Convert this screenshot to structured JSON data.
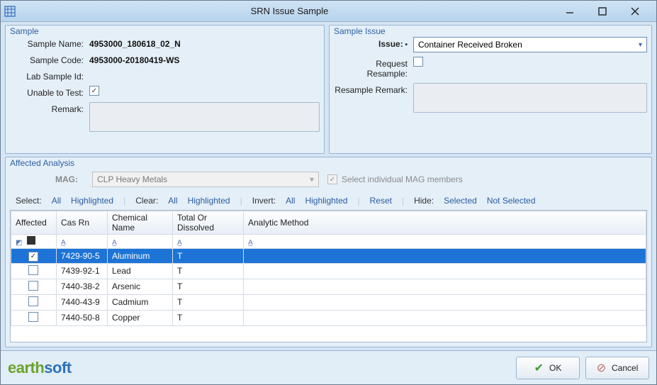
{
  "window": {
    "title": "SRN Issue Sample"
  },
  "sample": {
    "group_title": "Sample",
    "name_label": "Sample Name:",
    "name_value": "4953000_180618_02_N",
    "code_label": "Sample Code:",
    "code_value": "4953000-20180419-WS",
    "labid_label": "Lab Sample Id:",
    "labid_value": "",
    "unable_label": "Unable to Test:",
    "unable_checked": "✓",
    "remark_label": "Remark:"
  },
  "issue": {
    "group_title": "Sample Issue",
    "issue_label": "Issue:",
    "issue_value": "Container Received Broken",
    "resample_label": "Request Resample:",
    "resample_remark_label": "Resample Remark:"
  },
  "affected": {
    "group_title": "Affected Analysis",
    "mag_label": "MAG:",
    "mag_value": "CLP Heavy Metals",
    "mag_individual": "Select individual MAG members"
  },
  "toolbar": {
    "select": "Select:",
    "all": "All",
    "highlighted": "Highlighted",
    "clear": "Clear:",
    "invert": "Invert:",
    "reset": "Reset",
    "hide": "Hide:",
    "selected": "Selected",
    "notselected": "Not Selected"
  },
  "table": {
    "headers": {
      "affected": "Affected",
      "cas": "Cas Rn",
      "chem": "Chemical Name",
      "tod": "Total Or Dissolved",
      "method": "Analytic Method"
    },
    "rows": [
      {
        "checked": true,
        "cas": "7429-90-5",
        "chem": "Aluminum",
        "tod": "T",
        "method": "",
        "selected": true
      },
      {
        "checked": false,
        "cas": "7439-92-1",
        "chem": "Lead",
        "tod": "T",
        "method": "",
        "selected": false
      },
      {
        "checked": false,
        "cas": "7440-38-2",
        "chem": "Arsenic",
        "tod": "T",
        "method": "",
        "selected": false
      },
      {
        "checked": false,
        "cas": "7440-43-9",
        "chem": "Cadmium",
        "tod": "T",
        "method": "",
        "selected": false
      },
      {
        "checked": false,
        "cas": "7440-50-8",
        "chem": "Copper",
        "tod": "T",
        "method": "",
        "selected": false
      }
    ]
  },
  "buttons": {
    "ok": "OK",
    "cancel": "Cancel"
  },
  "logo": {
    "part1": "earth",
    "part2": "soft"
  }
}
